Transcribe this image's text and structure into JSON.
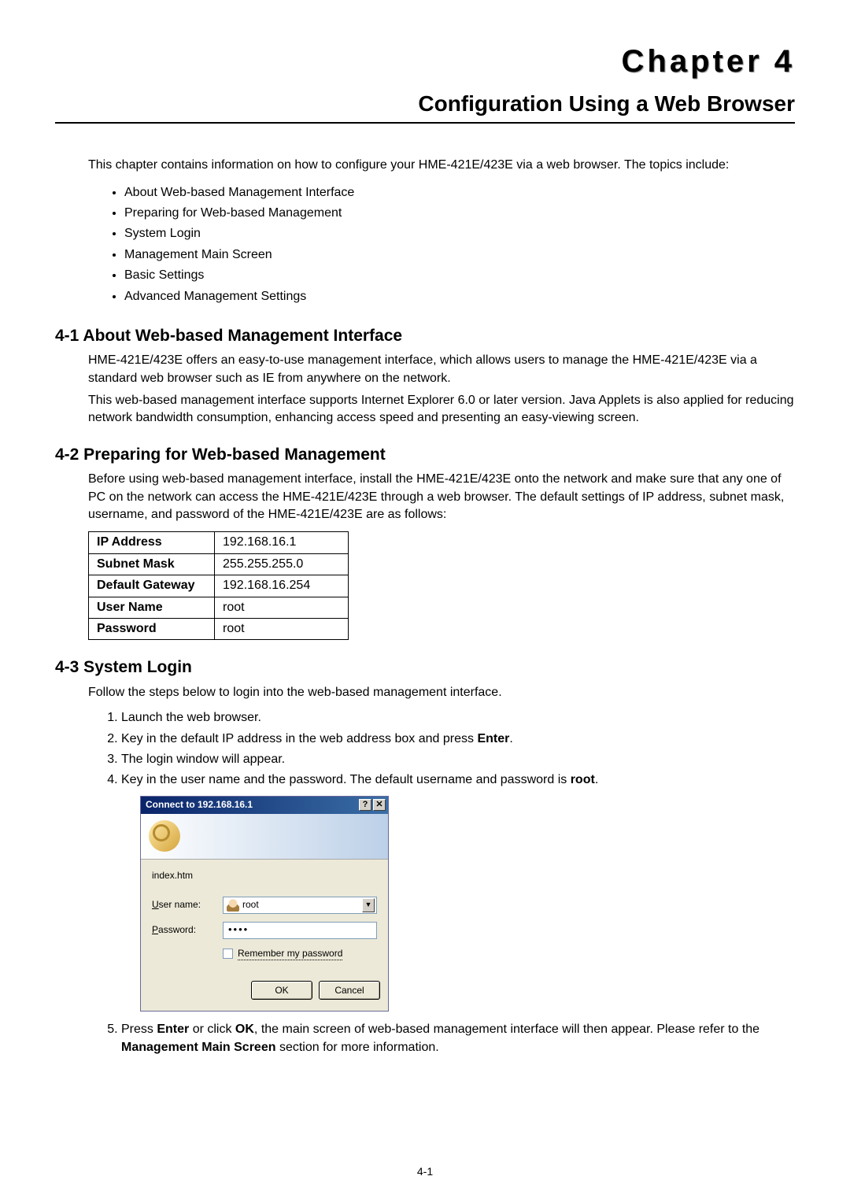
{
  "header": {
    "chapter": "Chapter 4",
    "subtitle": "Configuration Using a Web Browser"
  },
  "intro": "This chapter contains information on how to configure your HME-421E/423E via a web browser. The topics include:",
  "topics": [
    "About Web-based Management Interface",
    "Preparing for Web-based Management",
    "System Login",
    "Management Main Screen",
    "Basic Settings",
    "Advanced Management Settings"
  ],
  "sec41": {
    "title": "4-1 About Web-based Management Interface",
    "p1": "HME-421E/423E offers an easy-to-use management interface, which allows users to manage the HME-421E/423E via a standard web browser such as IE from anywhere on the network.",
    "p2": "This web-based management interface supports Internet Explorer 6.0 or later version. Java Applets is also applied for reducing network bandwidth consumption, enhancing access speed and presenting an easy-viewing screen."
  },
  "sec42": {
    "title": "4-2 Preparing for Web-based Management",
    "p1": "Before using web-based management interface, install the HME-421E/423E onto the network and make sure that any one of PC on the network can access the HME-421E/423E through a web browser. The default settings of IP address, subnet mask, username, and password of the HME-421E/423E are as follows:",
    "rows": [
      {
        "k": "IP Address",
        "v": "192.168.16.1"
      },
      {
        "k": "Subnet Mask",
        "v": "255.255.255.0"
      },
      {
        "k": "Default Gateway",
        "v": "192.168.16.254"
      },
      {
        "k": "User Name",
        "v": "root"
      },
      {
        "k": "Password",
        "v": "root"
      }
    ]
  },
  "sec43": {
    "title": "4-3 System Login",
    "intro": "Follow the steps below to login into the web-based management interface.",
    "steps": {
      "s1": "Launch the web browser.",
      "s2a": "Key in the default IP address in the web address box and press ",
      "s2b": "Enter",
      "s2c": ".",
      "s3": "The login window will appear.",
      "s4a": "Key in the user name and the password. The default username and password is ",
      "s4b": "root",
      "s4c": ".",
      "s5a": "Press ",
      "s5b": "Enter",
      "s5c": " or click ",
      "s5d": "OK",
      "s5e": ", the main screen of web-based management interface will then appear. Please refer to the ",
      "s5f": "Management Main Screen",
      "s5g": " section for more information."
    }
  },
  "dialog": {
    "title": "Connect to 192.168.16.1",
    "help": "?",
    "close": "✕",
    "file": "index.htm",
    "user_label_u": "U",
    "user_label_rest": "ser name:",
    "user_value": "root",
    "pass_label_u": "P",
    "pass_label_rest": "assword:",
    "pass_value": "••••",
    "remember_u": "R",
    "remember_rest": "emember my password",
    "ok": "OK",
    "cancel": "Cancel",
    "drop": "▼"
  },
  "page_num": "4-1"
}
